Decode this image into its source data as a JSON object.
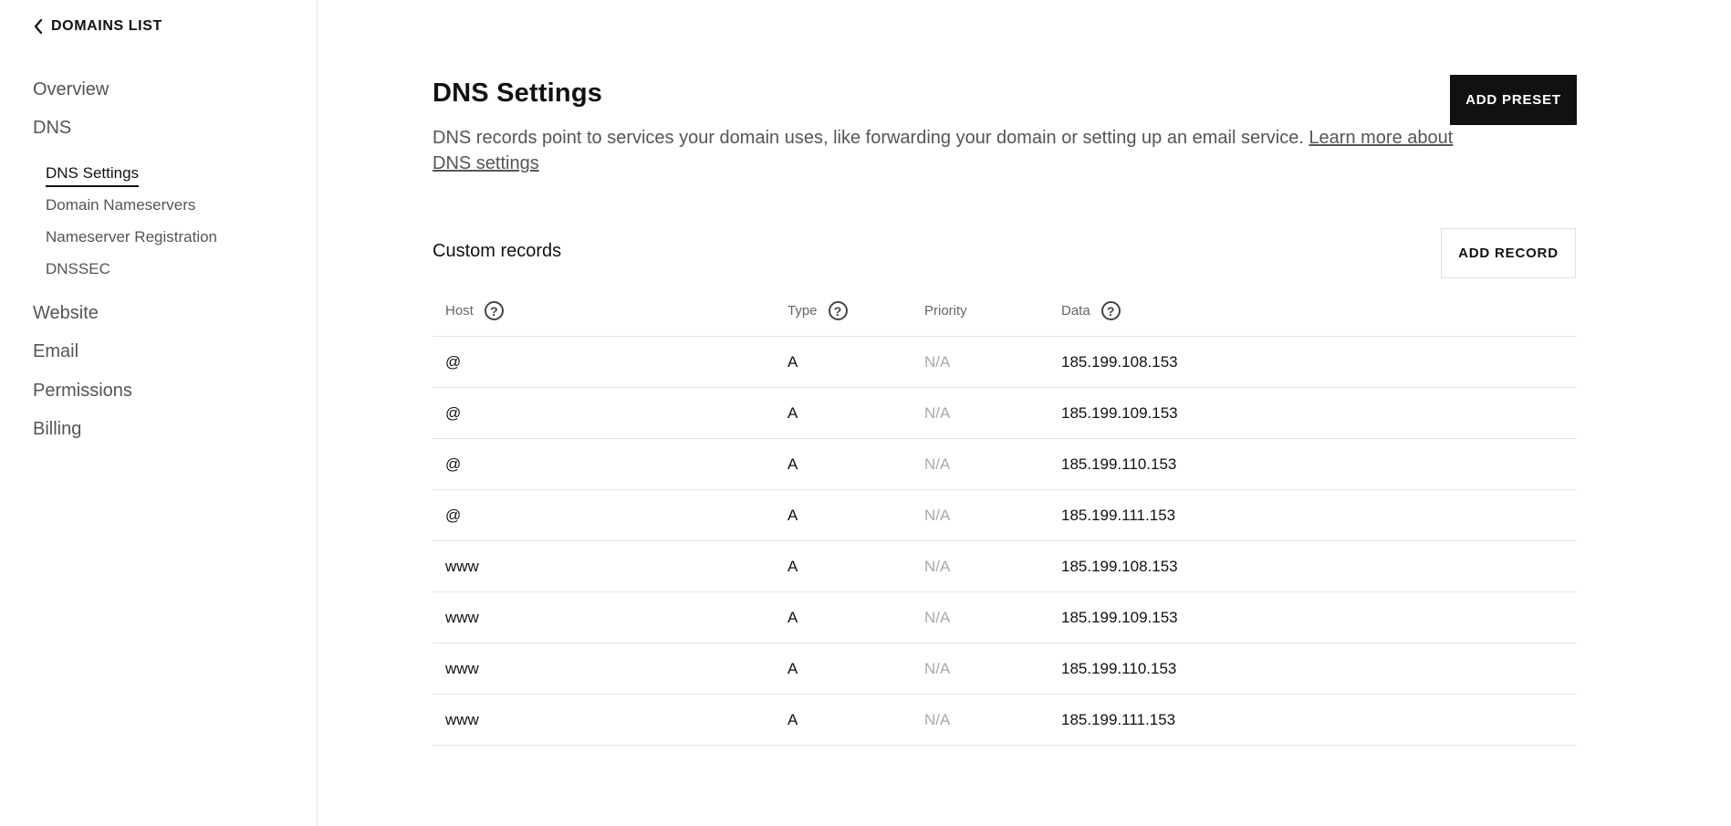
{
  "sidebar": {
    "back_label": "DOMAINS LIST",
    "items": [
      {
        "label": "Overview"
      },
      {
        "label": "DNS"
      },
      {
        "label": "Website"
      },
      {
        "label": "Email"
      },
      {
        "label": "Permissions"
      },
      {
        "label": "Billing"
      }
    ],
    "dns_sub_items": [
      {
        "label": "DNS Settings",
        "active": true
      },
      {
        "label": "Domain Nameservers",
        "active": false
      },
      {
        "label": "Nameserver Registration",
        "active": false
      },
      {
        "label": "DNSSEC",
        "active": false
      }
    ]
  },
  "main": {
    "title": "DNS Settings",
    "description": "DNS records point to services your domain uses, like forwarding your domain or setting up an email service.",
    "learn_more_link": "Learn more about DNS settings",
    "add_preset_label": "ADD PRESET",
    "custom_records_title": "Custom records",
    "add_record_label": "ADD RECORD"
  },
  "table": {
    "headers": {
      "host": "Host",
      "type": "Type",
      "priority": "Priority",
      "data": "Data"
    },
    "rows": [
      {
        "host": "@",
        "type": "A",
        "priority": "N/A",
        "data": "185.199.108.153"
      },
      {
        "host": "@",
        "type": "A",
        "priority": "N/A",
        "data": "185.199.109.153"
      },
      {
        "host": "@",
        "type": "A",
        "priority": "N/A",
        "data": "185.199.110.153"
      },
      {
        "host": "@",
        "type": "A",
        "priority": "N/A",
        "data": "185.199.111.153"
      },
      {
        "host": "www",
        "type": "A",
        "priority": "N/A",
        "data": "185.199.108.153"
      },
      {
        "host": "www",
        "type": "A",
        "priority": "N/A",
        "data": "185.199.109.153"
      },
      {
        "host": "www",
        "type": "A",
        "priority": "N/A",
        "data": "185.199.110.153"
      },
      {
        "host": "www",
        "type": "A",
        "priority": "N/A",
        "data": "185.199.111.153"
      }
    ]
  },
  "icons": {
    "back": "chevron-left-icon",
    "help": "question-circle-icon"
  },
  "colors": {
    "primary_button": "#111111",
    "muted_text": "#aaaaaa",
    "nav_text": "#555555"
  }
}
